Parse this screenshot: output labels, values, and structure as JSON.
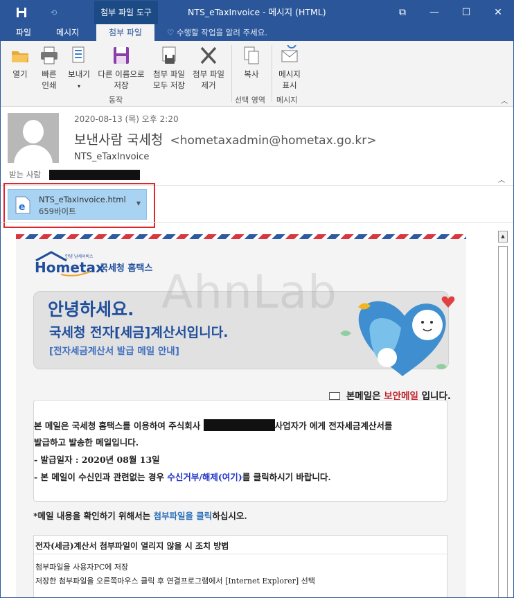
{
  "window": {
    "title": "NTS_eTaxInvoice - 메시지 (HTML)",
    "context_tab": "첨부 파일 도구",
    "controls": {
      "restore": "⧉",
      "minimize": "—",
      "maximize": "☐",
      "close": "✕"
    }
  },
  "ribbon_tabs": [
    {
      "label": "파일"
    },
    {
      "label": "메시지"
    },
    {
      "label": "첨부 파일",
      "active": true
    }
  ],
  "tell_me": "수행할 작업을 알려 주세요.",
  "ribbon": {
    "open": "열기",
    "quick_print": [
      "빠른",
      "인쇄"
    ],
    "send_to": [
      "보내기",
      "▾"
    ],
    "save_as": [
      "다른 이름으로",
      "저장"
    ],
    "save_all": [
      "첨부 파일",
      "모두 저장"
    ],
    "remove": [
      "첨부 파일",
      "제거"
    ],
    "copy": "복사",
    "show_message": [
      "메시지",
      "표시"
    ],
    "groups": {
      "actions": "동작",
      "selection": "선택 영역",
      "message": "메시지"
    }
  },
  "header": {
    "date": "2020-08-13 (목) 오후 2:20",
    "sender_label": "보낸사람",
    "sender_name": "국세청",
    "sender_email": "<hometaxadmin@hometax.go.kr>",
    "subject": "NTS_eTaxInvoice",
    "to_label": "받는 사람"
  },
  "attachment": {
    "name": "NTS_eTaxInvoice.html",
    "size": "659바이트"
  },
  "body": {
    "logo_tagline": "안녕 납세서비스",
    "logo_brand": "Hometax",
    "logo_name": "국세청 홈택스",
    "banner_hello": "안녕하세요.",
    "banner_line": "국세청 전자[세금]계산서입니다.",
    "banner_sub": "[전자세금계산서 발급 메일 안내]",
    "secure_prefix": "본메일은",
    "secure_red": "보안메일",
    "secure_suffix": "입니다.",
    "p1_before": "본 메일은 국세청 홈택스를 이용하여 주식회사",
    "p1_after": "사업자가 에게 전자세금계산서를",
    "p2": "발급하고 발송한 메일입니다.",
    "p3": "- 발급일자 : 2020년 08월 13일",
    "p4_before": "- 본 메일이 수신인과 관련없는 경우",
    "p4_link": "수신거부/해제(여기)",
    "p4_after": "를 클릭하시기 바랍니다.",
    "note_before": "*메일 내용을 확인하기 위해서는",
    "note_link": "첨부파일을 클릭",
    "note_after": "하십시오.",
    "fix_title": "전자(세금)계산서 첨부파일이 열리지 않을 시 조치 방법",
    "fix_line1": "첨부파일을 사용자PC에 저장",
    "fix_line2": "저장한 첨부파일을 오른쪽마우스 클릭 후 연결프로그램에서 [Internet Explorer] 선택"
  },
  "watermark": "AhnLab",
  "colors": {
    "accent": "#2b579a",
    "banner_blue": "#1f4e9c",
    "secure_red": "#c0272d",
    "attachment_bg": "#a8d3f2",
    "highlight_outline": "#e0262b"
  }
}
